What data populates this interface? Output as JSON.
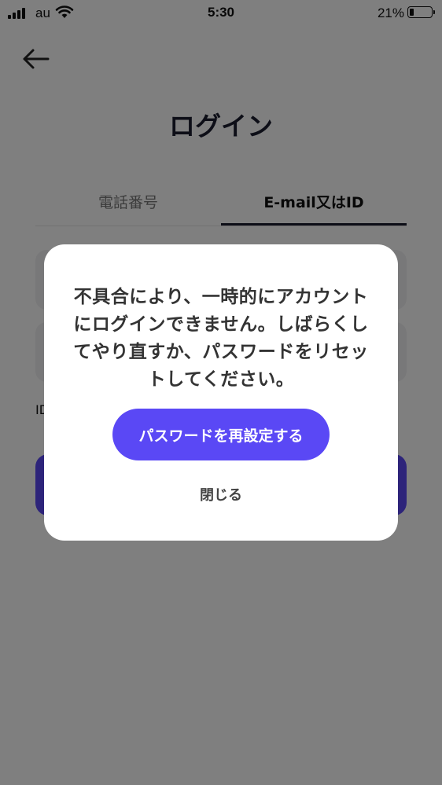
{
  "status_bar": {
    "carrier": "au",
    "time": "5:30",
    "battery_percent": "21%",
    "battery_level": 0.21
  },
  "header": {
    "back_icon": "arrow-left-icon",
    "title": "ログイン"
  },
  "tabs": [
    {
      "label": "電話番号",
      "active": false
    },
    {
      "label": "E-mail又はID",
      "active": true
    }
  ],
  "form": {
    "id_prefix": "ID"
  },
  "modal": {
    "message": "不具合により、一時的にアカウントにログインできません。しばらくしてやり直すか、パスワードをリセットしてください。",
    "reset_button": "パスワードを再設定する",
    "close_button": "閉じる"
  },
  "colors": {
    "accent": "#5a48f5",
    "overlay": "rgba(0,0,0,0.5)",
    "title": "#1a1d2e"
  }
}
